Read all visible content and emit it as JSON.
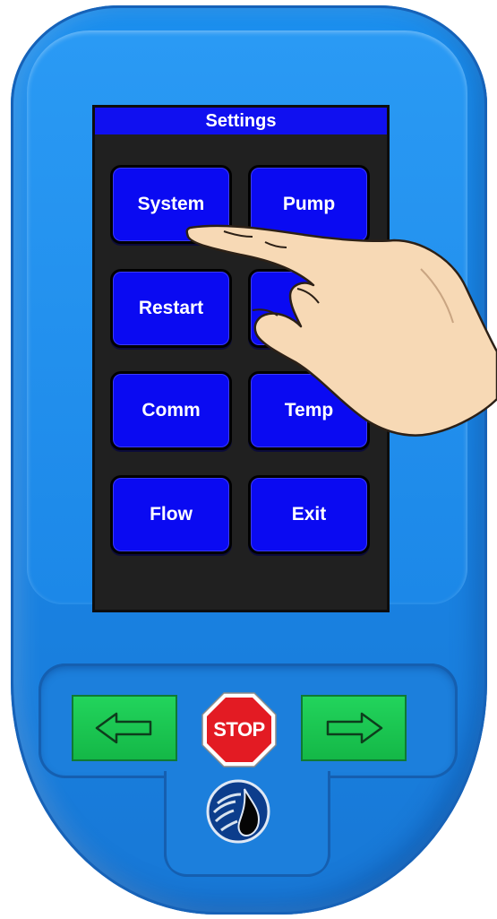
{
  "screen": {
    "title": "Settings",
    "buttons": [
      {
        "label": "System"
      },
      {
        "label": "Pump"
      },
      {
        "label": "Restart"
      },
      {
        "label": ""
      },
      {
        "label": "Comm"
      },
      {
        "label": "Temp"
      },
      {
        "label": "Flow"
      },
      {
        "label": "Exit"
      }
    ]
  },
  "keypad": {
    "stop_label": "STOP"
  },
  "colors": {
    "device_body": "#1a86e6",
    "screen_bg": "#202020",
    "button": "#0a0af2",
    "title_bar": "#1010f0",
    "arrow_key": "#14b847",
    "stop_sign": "#e31b23"
  },
  "icons": {
    "left": "arrow-left-icon",
    "right": "arrow-right-icon",
    "logo": "water-drop-logo-icon"
  }
}
